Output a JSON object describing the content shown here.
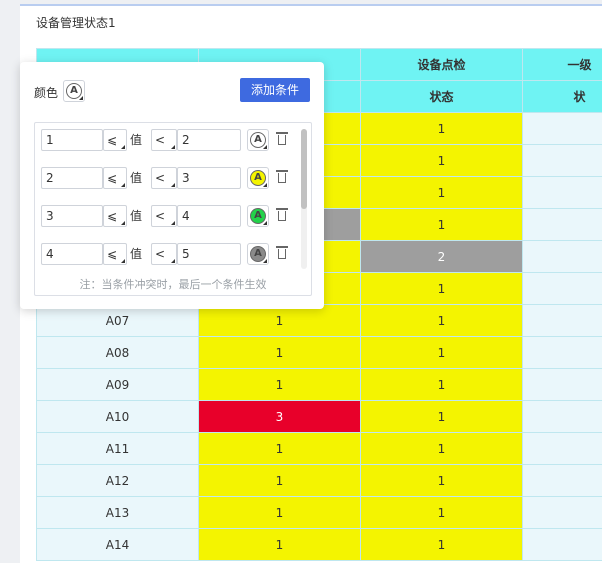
{
  "panel": {
    "title": "设备管理状态1"
  },
  "headers": {
    "row1": [
      "",
      "",
      "设备点检",
      "一级"
    ],
    "row2": [
      "",
      "",
      "状态",
      "状"
    ]
  },
  "rows": [
    {
      "name": "",
      "c1": "",
      "c1color": "yellow",
      "c2": "1",
      "c2color": "yellow"
    },
    {
      "name": "",
      "c1": "",
      "c1color": "yellow",
      "c2": "1",
      "c2color": "yellow"
    },
    {
      "name": "",
      "c1": "",
      "c1color": "yellow",
      "c2": "1",
      "c2color": "yellow"
    },
    {
      "name": "",
      "c1": "",
      "c1color": "gray",
      "c2": "1",
      "c2color": "yellow"
    },
    {
      "name": "",
      "c1": "",
      "c1color": "yellow",
      "c2": "2",
      "c2color": "gray"
    },
    {
      "name": "",
      "c1": "",
      "c1color": "yellow",
      "c2": "1",
      "c2color": "yellow"
    },
    {
      "name": "A07",
      "c1": "1",
      "c1color": "yellow",
      "c2": "1",
      "c2color": "yellow"
    },
    {
      "name": "A08",
      "c1": "1",
      "c1color": "yellow",
      "c2": "1",
      "c2color": "yellow"
    },
    {
      "name": "A09",
      "c1": "1",
      "c1color": "yellow",
      "c2": "1",
      "c2color": "yellow"
    },
    {
      "name": "A10",
      "c1": "3",
      "c1color": "red",
      "c2": "1",
      "c2color": "yellow"
    },
    {
      "name": "A11",
      "c1": "1",
      "c1color": "yellow",
      "c2": "1",
      "c2color": "yellow"
    },
    {
      "name": "A12",
      "c1": "1",
      "c1color": "yellow",
      "c2": "1",
      "c2color": "yellow"
    },
    {
      "name": "A13",
      "c1": "1",
      "c1color": "yellow",
      "c2": "1",
      "c2color": "yellow"
    },
    {
      "name": "A14",
      "c1": "1",
      "c1color": "yellow",
      "c2": "1",
      "c2color": "yellow"
    }
  ],
  "popup": {
    "color_label": "颜色",
    "add_label": "添加条件",
    "rules": [
      {
        "from": "1",
        "op1": "⩽",
        "value_label": "值",
        "op2": "<",
        "to": "2",
        "color": "#ffffff"
      },
      {
        "from": "2",
        "op1": "⩽",
        "value_label": "值",
        "op2": "<",
        "to": "3",
        "color": "#f4f400"
      },
      {
        "from": "3",
        "op1": "⩽",
        "value_label": "值",
        "op2": "<",
        "to": "4",
        "color": "#22d34a"
      },
      {
        "from": "4",
        "op1": "⩽",
        "value_label": "值",
        "op2": "<",
        "to": "5",
        "color": "#8a8a8a"
      }
    ],
    "note": "注：当条件冲突时，最后一个条件生效"
  },
  "colors": {
    "yellow": "#f4f400",
    "gray": "#9e9e9e",
    "red": "#e8002a",
    "header": "#6ff3f3",
    "accent": "#3e6ae0"
  }
}
